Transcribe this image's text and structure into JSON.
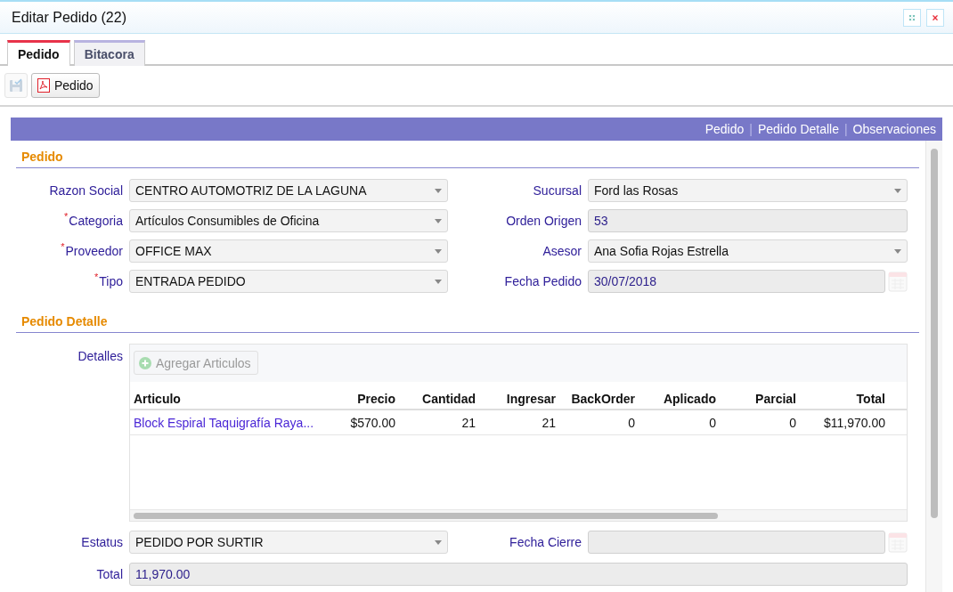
{
  "window": {
    "title": "Editar Pedido (22)"
  },
  "tabs": [
    {
      "label": "Pedido",
      "selected": true
    },
    {
      "label": "Bitacora",
      "selected": false
    }
  ],
  "toolbar": [
    {
      "kind": "save",
      "disabled": true
    },
    {
      "kind": "pdf",
      "label": "Pedido",
      "disabled": false
    }
  ],
  "section_links": [
    {
      "label": "Pedido"
    },
    {
      "separator": "|",
      "label": "Pedido Detalle"
    },
    {
      "separator": "|",
      "label": "Observaciones"
    }
  ],
  "pedido_section": {
    "title": "Pedido",
    "rows": [
      [
        {
          "label": "Razon Social",
          "kind": "select",
          "value": "CENTRO AUTOMOTRIZ DE LA LAGUNA"
        },
        {
          "label": "Sucursal",
          "kind": "select",
          "value": "Ford las Rosas"
        }
      ],
      [
        {
          "required_mark": "*",
          "label": "Categoria",
          "kind": "select",
          "value": "Artículos Consumibles de Oficina"
        },
        {
          "label": "Orden Origen",
          "kind": "text",
          "value": "53"
        }
      ],
      [
        {
          "required_mark": "*",
          "label": "Proveedor",
          "kind": "select",
          "value": "OFFICE MAX"
        },
        {
          "label": "Asesor",
          "kind": "select",
          "value": "Ana Sofia Rojas Estrella"
        }
      ],
      [
        {
          "required_mark": "*",
          "label": "Tipo",
          "kind": "select",
          "value": "ENTRADA PEDIDO"
        },
        {
          "label": "Fecha Pedido",
          "kind": "date",
          "value": "30/07/2018"
        }
      ]
    ]
  },
  "detalle_section": {
    "title": "Pedido Detalle",
    "label": "Detalles",
    "add_button": {
      "label": "Agregar Articulos",
      "disabled": true
    },
    "table": {
      "columns": [
        "Articulo",
        "Precio",
        "Cantidad",
        "Ingresar",
        "BackOrder",
        "Aplicado",
        "Parcial",
        "Total"
      ],
      "rows": [
        [
          "Block Espiral Taquigrafía Raya...",
          "$570.00",
          "21",
          "21",
          "0",
          "0",
          "0",
          "$11,970.00"
        ]
      ]
    }
  },
  "footer_rows": [
    [
      {
        "label": "Estatus",
        "kind": "select",
        "value": "PEDIDO POR SURTIR"
      },
      {
        "label": "Fecha Cierre",
        "kind": "date"
      }
    ],
    [
      {
        "label": "Total",
        "kind": "text",
        "value": "11,970.00"
      }
    ]
  ]
}
